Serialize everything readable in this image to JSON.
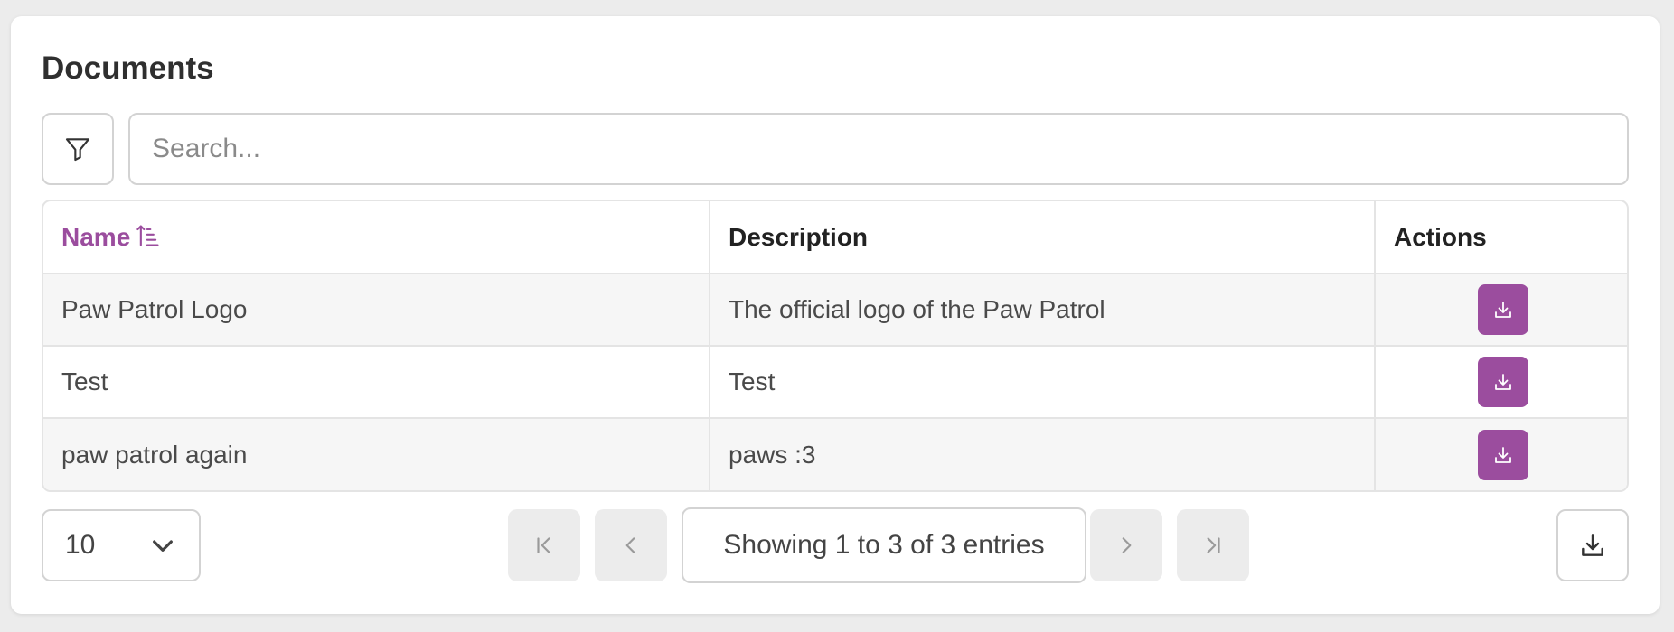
{
  "header": {
    "title": "Documents"
  },
  "search": {
    "placeholder": "Search...",
    "value": ""
  },
  "table": {
    "columns": [
      {
        "label": "Name",
        "sorted": "ascending"
      },
      {
        "label": "Description"
      },
      {
        "label": "Actions"
      }
    ],
    "rows": [
      {
        "name": "Paw Patrol Logo",
        "description": "The official logo of the Paw Patrol"
      },
      {
        "name": "Test",
        "description": "Test"
      },
      {
        "name": "paw patrol again",
        "description": "paws :3"
      }
    ]
  },
  "pagination": {
    "page_size": "10",
    "summary": "Showing 1 to 3 of 3 entries"
  },
  "colors": {
    "accent": "#9b4d9e",
    "disabled_button": "#ececec",
    "border": "#d3d3d3"
  },
  "icons": {
    "filter": "filter-icon",
    "sort": "sort-ascending-icon",
    "row_action": "download-icon",
    "first": "first-page-icon",
    "prev": "chevron-left-icon",
    "next": "chevron-right-icon",
    "last": "last-page-icon",
    "page_size": "chevron-down-icon",
    "export": "download-icon"
  }
}
